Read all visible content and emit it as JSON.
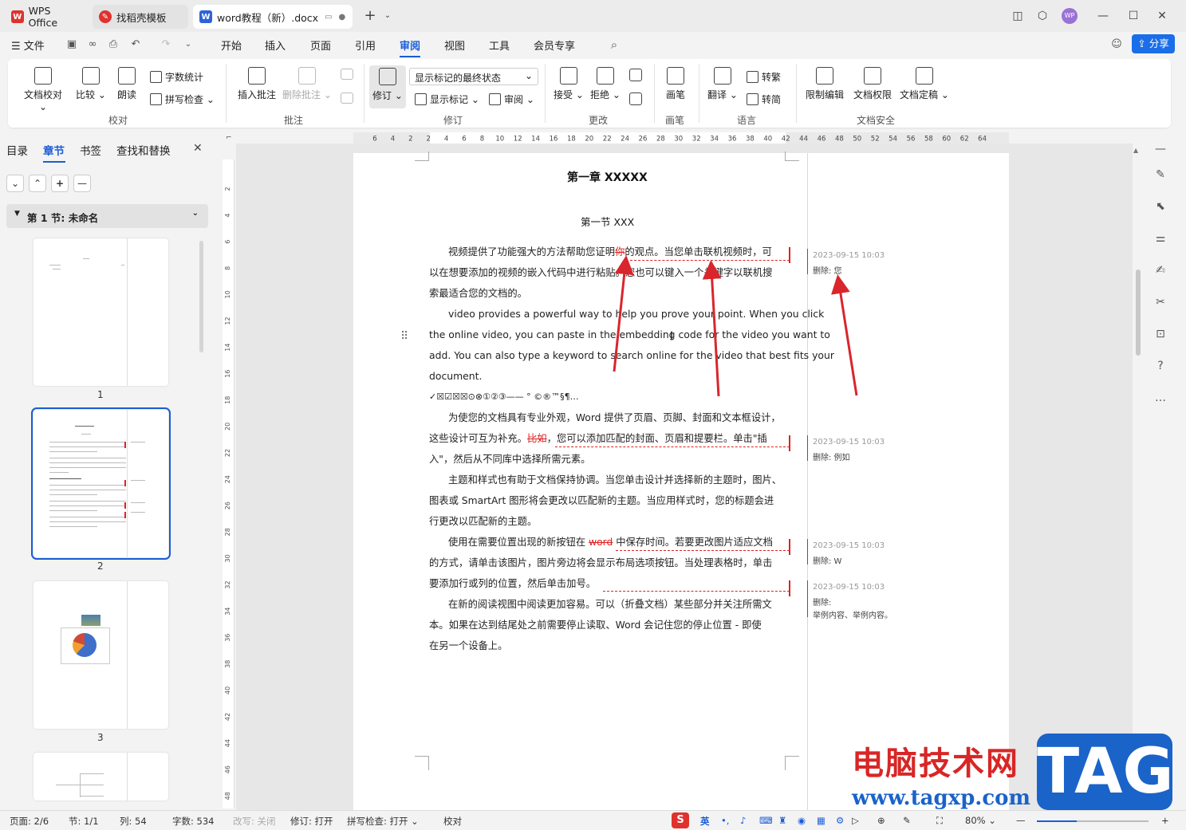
{
  "tabs": [
    {
      "label": "WPS Office",
      "icon": "wps-logo-icon"
    },
    {
      "label": "找稻壳模板",
      "icon": "docer-icon"
    },
    {
      "label": "word教程（新）.docx",
      "icon": "word-doc-icon"
    }
  ],
  "titlebar": {
    "avatar": "WP"
  },
  "menubar": {
    "file": "文件",
    "items": [
      "开始",
      "插入",
      "页面",
      "引用",
      "审阅",
      "视图",
      "工具",
      "会员专享"
    ],
    "active": "审阅",
    "share": "分享"
  },
  "ribbon": {
    "proof": {
      "doc_check": "文档校对",
      "compare": "比较",
      "read_aloud": "朗读",
      "word_count": "字数统计",
      "spell_check": "拼写检查",
      "label": "校对"
    },
    "comments": {
      "insert": "插入批注",
      "delete": "删除批注",
      "label": "批注"
    },
    "revision": {
      "track": "修订",
      "display_mode": "显示标记的最终状态",
      "show_markup": "显示标记",
      "review_pane": "审阅",
      "label": "修订"
    },
    "changes": {
      "accept": "接受",
      "reject": "拒绝",
      "label": "更改"
    },
    "pen": {
      "draw": "画笔",
      "label": "画笔"
    },
    "language": {
      "translate": "翻译",
      "to_trad": "转繁",
      "to_simp": "转简",
      "label": "语言"
    },
    "security": {
      "restrict": "限制编辑",
      "permission": "文档权限",
      "finalize": "文档定稿",
      "label": "文档安全"
    }
  },
  "left_panel": {
    "tabs": [
      "目录",
      "章节",
      "书签",
      "查找和替换"
    ],
    "active_tab": "章节",
    "section": "第 1 节: 未命名",
    "pages": [
      "1",
      "2",
      "3"
    ]
  },
  "ruler": {
    "h": [
      "6",
      "4",
      "2",
      "2",
      "4",
      "6",
      "8",
      "10",
      "12",
      "14",
      "16",
      "18",
      "20",
      "22",
      "24",
      "26",
      "28",
      "30",
      "32",
      "34",
      "36",
      "38",
      "40",
      "42",
      "44",
      "46",
      "48",
      "50",
      "52",
      "54",
      "56",
      "58",
      "60",
      "62",
      "64"
    ],
    "v": [
      "2",
      "4",
      "6",
      "8",
      "10",
      "12",
      "14",
      "16",
      "18",
      "20",
      "22",
      "24",
      "26",
      "28",
      "30",
      "32",
      "34",
      "36",
      "38",
      "40",
      "42",
      "44",
      "46",
      "48"
    ]
  },
  "document": {
    "chapter_title": "第一章 XXXXX",
    "section_title": "第一节 XXX",
    "p1_a": "视频提供了功能强大的方法帮助您证明",
    "p1_del": "你",
    "p1_b": "的观点。当您单击联机视频时，可",
    "p1_line2": "以在想要添加的视频的嵌入代码中进行粘贴。您也可以键入一个关键字以联机搜",
    "p1_line3": "索最适合您的文档的。",
    "p2_l1": "video provides a powerful way to help you prove your point. When you click",
    "p2_l2": "the online video, you can paste in the embedding code for the video you want to",
    "p2_l3": "add. You can also type a keyword to search online for the video that best fits your",
    "p2_l4": "document.",
    "symbols": "✓☒☑☒☒⊙⊗①②③——   °  ©®™§¶…",
    "p3_l1": "为使您的文档具有专业外观，Word 提供了页眉、页脚、封面和文本框设计，",
    "p3_l2a": "这些设计可互为补充。",
    "p3_del": "比如",
    "p3_l2b": "，您可以添加匹配的封面、页眉和提要栏。单击\"插",
    "p3_l3": "入\"，然后从不同库中选择所需元素。",
    "p4_l1": "主题和样式也有助于文档保持协调。当您单击设计并选择新的主题时，图片、",
    "p4_l2": "图表或 SmartArt 图形将会更改以匹配新的主题。当应用样式时，您的标题会进",
    "p4_l3": "行更改以匹配新的主题。",
    "p5_l1a": "使用在需要位置出现的新按钮在 ",
    "p5_del": "word",
    "p5_l1b": " 中保存时间。若要更改图片适应文档",
    "p5_l2": "的方式，请单击该图片，图片旁边将会显示布局选项按钮。当处理表格时，单击",
    "p5_l3": "要添加行或列的位置，然后单击加号。",
    "p6_l1": "在新的阅读视图中阅读更加容易。可以（折叠文档）某些部分并关注所需文",
    "p6_l2": "本。如果在达到结尾处之前需要停止读取、Word 会记住您的停止位置 - 即使",
    "p6_l3": "在另一个设备上。"
  },
  "comments": [
    {
      "time": "2023-09-15 10:03",
      "body": "删除: 您"
    },
    {
      "time": "2023-09-15 10:03",
      "body": "删除: 例如"
    },
    {
      "time": "2023-09-15 10:03",
      "body": "删除: W"
    },
    {
      "time": "2023-09-15 10:03",
      "body": "删除:",
      "extra": "举例内容、举例内容。"
    }
  ],
  "statusbar": {
    "page": "页面: 2/6",
    "section": "节: 1/1",
    "column": "列: 54",
    "words": "字数: 534",
    "overtype": "改写: 关闭",
    "track": "修订: 打开",
    "spell": "拼写检查: 打开",
    "proof": "校对",
    "ime": "英",
    "zoom": "80%"
  },
  "watermark": {
    "cn": "电脑技术网",
    "url": "www.tagxp.com",
    "tag": "TAG"
  },
  "colors": {
    "accent": "#1a5dd6",
    "revision_red": "#d22222",
    "arrow_red": "#d8262c"
  }
}
